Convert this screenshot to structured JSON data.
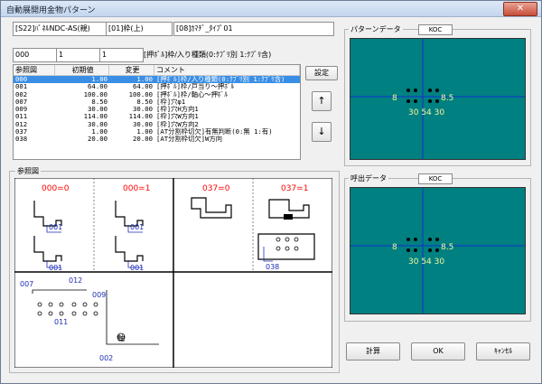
{
  "window": {
    "title": "自動展開用金物パターン",
    "close_glyph": "✕"
  },
  "fields": {
    "f1": "[S22]ﾊﾟﾈﾙNDC-AS(親)",
    "f2": "[01]枠(上)",
    "f3": "[08]ｶﾏﾁﾞ_ﾀｲﾌﾟ01",
    "f4": "000",
    "f5": "1",
    "f6": "1",
    "desc": "[押ﾎﾞﾙ]枠/入り種類(0:ｸﾌﾞﾘ別 1:ｸﾌﾞﾘ含)"
  },
  "buttons": {
    "setting": "設定",
    "up": "↑",
    "down": "↓",
    "calc": "計算",
    "ok": "OK",
    "cancel": "ｷｬﾝｾﾙ"
  },
  "table": {
    "headers": [
      "参照図",
      "初期値",
      "変更",
      "コメント"
    ],
    "rows": [
      [
        "000",
        "1.00",
        "1.00",
        "[押ﾎﾞﾙ]枠/入り種類(0:ｸﾌﾞﾘ別 1:ｸﾌﾞﾘ含)"
      ],
      [
        "001",
        "64.00",
        "64.00",
        "[押ﾎﾞﾙ]枠/戸当り～押ﾎﾞﾙ"
      ],
      [
        "002",
        "100.00",
        "100.00",
        "[押ﾎﾞﾙ]枠/軸心～押ﾎﾞﾙ"
      ],
      [
        "007",
        "8.50",
        "8.50",
        "[枠]穴φ1"
      ],
      [
        "009",
        "30.00",
        "30.00",
        "[枠]穴H方向1"
      ],
      [
        "011",
        "114.00",
        "114.00",
        "[枠]穴W方向1"
      ],
      [
        "012",
        "30.00",
        "30.00",
        "[枠]穴W方向2"
      ],
      [
        "037",
        "1.00",
        "1.00",
        "[AT分割枠切欠]有無判断(0:無 1:有)"
      ],
      [
        "038",
        "20.00",
        "20.00",
        "[AT分割枠切欠]W方向"
      ]
    ]
  },
  "ref": {
    "label": "参照図",
    "cells": [
      "000=0",
      "000=1",
      "037=0",
      "037=1"
    ],
    "tags": [
      "001",
      "001",
      "001",
      "001",
      "038",
      "007",
      "012",
      "009",
      "011",
      "002"
    ],
    "hinge": "軸"
  },
  "pattern": {
    "label": "パターンデータ",
    "tag": "KOC",
    "dim_left": "8",
    "dim_right": "8.5",
    "dim_bottom": "30 54 30"
  },
  "call": {
    "label": "呼出データ",
    "tag": "KOC",
    "dim_left": "8",
    "dim_right": "8.5",
    "dim_bottom": "30 54 30"
  },
  "colors": {
    "canvas": "#008080",
    "selection": "#3a8ee6",
    "ref_red": "#ff0000",
    "ref_blue": "#1b2db5",
    "yellow_dim": "#f5f5a0"
  }
}
